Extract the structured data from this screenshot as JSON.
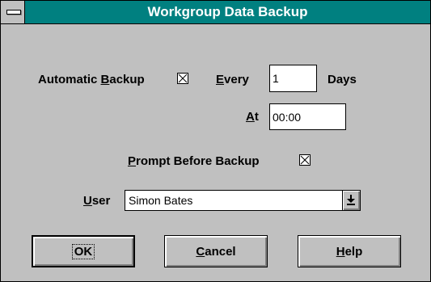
{
  "window": {
    "title": "Workgroup Data Backup"
  },
  "automatic_backup": {
    "before": "Automatic ",
    "mnemonic": "B",
    "after": "ackup",
    "checked": true
  },
  "every": {
    "mnemonic": "E",
    "after": "very",
    "value": "1",
    "unit": "Days"
  },
  "at": {
    "mnemonic": "A",
    "after": "t",
    "value": "00:00"
  },
  "prompt_before_backup": {
    "mnemonic": "P",
    "after": "rompt Before Backup",
    "checked": true
  },
  "user": {
    "mnemonic": "U",
    "after": "ser",
    "value": "Simon Bates"
  },
  "buttons": {
    "ok": {
      "label": "OK"
    },
    "cancel": {
      "mnemonic": "C",
      "after": "ancel"
    },
    "help": {
      "mnemonic": "H",
      "after": "elp"
    }
  },
  "icons": {
    "system_menu": "system-menu-icon",
    "checkbox_mark": "checkbox-x-icon",
    "dropdown": "dropdown-arrow-icon"
  }
}
